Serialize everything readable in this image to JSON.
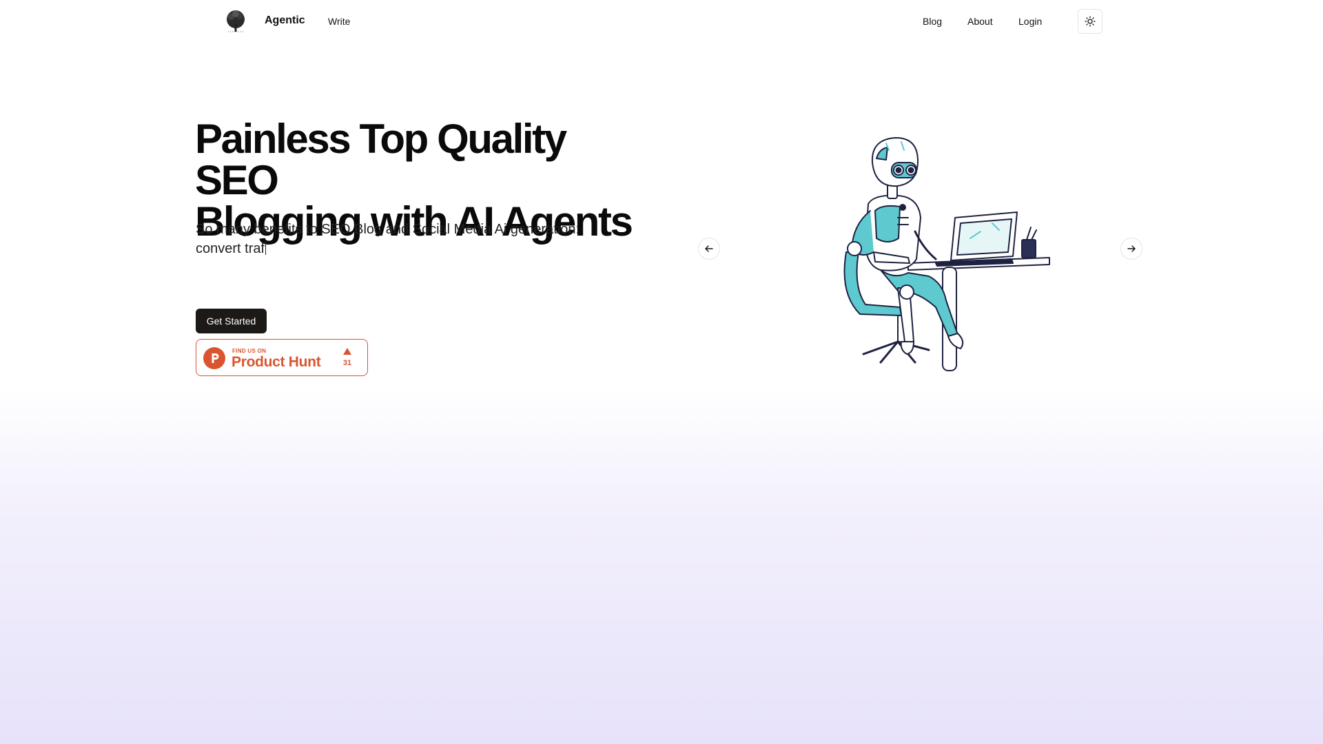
{
  "nav": {
    "brand": "Agentic",
    "write": "Write",
    "blog": "Blog",
    "about": "About",
    "login": "Login",
    "logo_icon": "tree-logo-icon",
    "theme_icon": "sun-icon"
  },
  "hero": {
    "title_line1": "Painless Top Quality SEO",
    "title_line2": "Blogging with AI Agents",
    "subtitle_line1": "So many benefits to SEO Blog and Social Media Ai generation:",
    "subtitle_line2": "convert traf",
    "cta": "Get Started"
  },
  "product_hunt": {
    "small": "FIND US ON",
    "big": "Product Hunt",
    "count": "31",
    "color": "#da552f"
  },
  "carousel": {
    "prev_icon": "arrow-left-icon",
    "next_icon": "arrow-right-icon",
    "image_icon": "robot-at-desk-illustration"
  }
}
